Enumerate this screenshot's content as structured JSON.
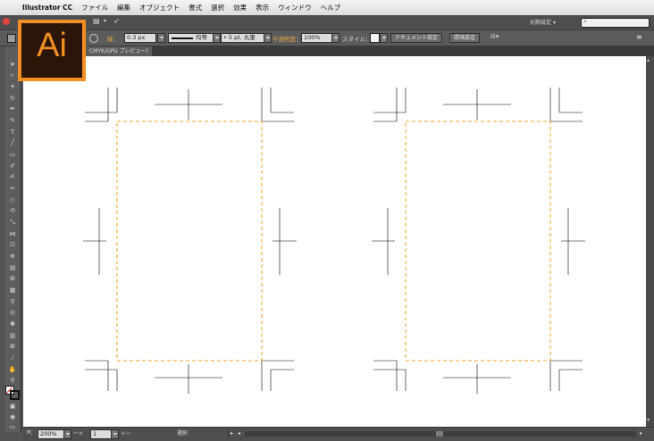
{
  "menubar": {
    "app_name": "Illustrator CC",
    "items": [
      "ファイル",
      "編集",
      "オブジェクト",
      "書式",
      "選択",
      "効果",
      "表示",
      "ウィンドウ",
      "ヘルプ"
    ]
  },
  "workspace": {
    "label": "初期設定",
    "chevron": "▾"
  },
  "search": {
    "icon": "⌕"
  },
  "control_bar": {
    "stroke_label": "線：",
    "stroke_weight": "0.3 px",
    "stroke_profile": "均等",
    "brush": "5 pt. 丸筆",
    "opacity_label": "不透明度：",
    "opacity_value": "100%",
    "style_label": "スタイル：",
    "doc_setup_button": "ドキュメント設定",
    "prefs_button": "環境設定"
  },
  "document_tab": {
    "label": "CMYK/GPU プレビュー)"
  },
  "status_bar": {
    "zoom": "200%",
    "artboard": "1",
    "mode": "選択"
  },
  "logo": {
    "text": "Ai"
  },
  "colors": {
    "accent": "#f38e22",
    "guide": "#f0a020",
    "crop_mark": "#000000",
    "canvas": "#ffffff",
    "chrome": "#535353"
  },
  "icons": [
    "apple-icon",
    "search-icon",
    "selection-tool-icon",
    "direct-selection-icon",
    "pen-tool-icon",
    "type-tool-icon",
    "line-tool-icon",
    "rectangle-tool-icon",
    "brush-tool-icon",
    "pencil-tool-icon",
    "eraser-tool-icon",
    "rotate-tool-icon",
    "scale-tool-icon",
    "width-tool-icon",
    "shape-builder-icon",
    "gradient-tool-icon",
    "eyedropper-tool-icon",
    "blend-tool-icon",
    "symbol-sprayer-icon",
    "graph-tool-icon",
    "artboard-tool-icon",
    "slice-tool-icon",
    "hand-tool-icon",
    "zoom-tool-icon",
    "fill-stroke-icon",
    "screen-mode-icon",
    "send-arrow-icon"
  ]
}
